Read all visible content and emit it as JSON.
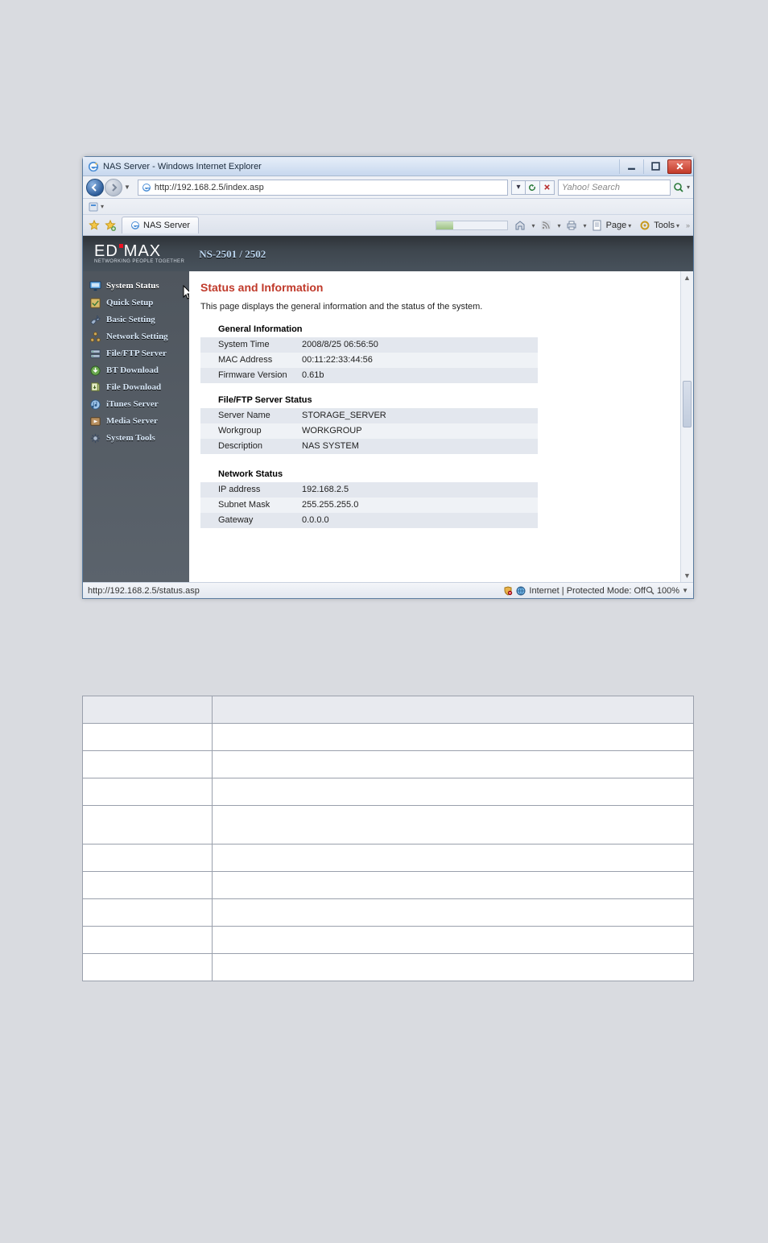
{
  "window": {
    "title": "NAS Server - Windows Internet Explorer",
    "url": "http://192.168.2.5/index.asp",
    "search_placeholder": "Yahoo! Search",
    "tab_label": "NAS Server",
    "cmd_page": "Page",
    "cmd_tools": "Tools"
  },
  "brand": {
    "name_left": "ED",
    "name_right": "MAX",
    "tagline": "NETWORKING PEOPLE TOGETHER",
    "model": "NS-2501 / 2502"
  },
  "menu": {
    "items": [
      "System Status",
      "Quick Setup",
      "Basic Setting",
      "Network Setting",
      "File/FTP Server",
      "BT Download",
      "File Download",
      "iTunes Server",
      "Media Server",
      "System Tools"
    ]
  },
  "page": {
    "heading": "Status and Information",
    "lead": "This page displays the general information and the status of the system.",
    "sections": {
      "general": {
        "title": "General Information",
        "rows": [
          [
            "System Time",
            "2008/8/25 06:56:50"
          ],
          [
            "MAC Address",
            "00:11:22:33:44:56"
          ],
          [
            "Firmware Version",
            "0.61b"
          ]
        ]
      },
      "fileftp": {
        "title": "File/FTP Server Status",
        "rows": [
          [
            "Server Name",
            "STORAGE_SERVER"
          ],
          [
            "Workgroup",
            "WORKGROUP"
          ],
          [
            "Description",
            "NAS SYSTEM"
          ]
        ]
      },
      "network": {
        "title": "Network Status",
        "rows": [
          [
            "IP address",
            "192.168.2.5"
          ],
          [
            "Subnet Mask",
            "255.255.255.0"
          ],
          [
            "Gateway",
            "0.0.0.0"
          ]
        ]
      }
    }
  },
  "status": {
    "left": "http://192.168.2.5/status.asp",
    "mid": "Internet | Protected Mode: Off",
    "zoom": "100%"
  }
}
